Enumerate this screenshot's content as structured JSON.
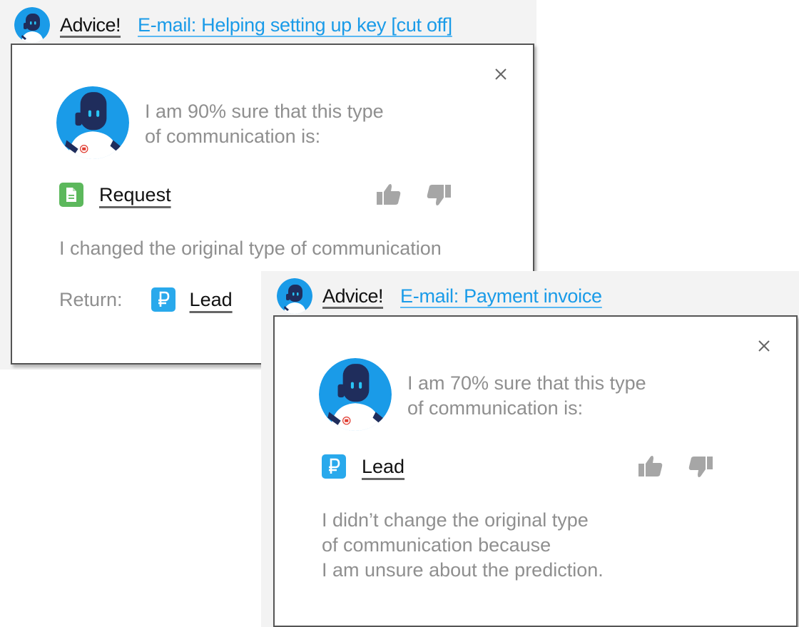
{
  "colors": {
    "accent_blue": "#1a9be8",
    "request_green": "#5cb85c",
    "lead_blue": "#29a9ec",
    "muted_text": "#8f8f8f",
    "thumb_gray": "#a6a6a6",
    "robot_navy": "#1f2d5c"
  },
  "cards": [
    {
      "header": {
        "advice_label": "Advice!",
        "email_link": "E-mail: Helping setting up key [cut off]"
      },
      "close_icon": "close-icon",
      "confidence_line1": "I am 90% sure that this type",
      "confidence_line2": "of communication is:",
      "confidence_percent": 90,
      "predicted_type": {
        "label": "Request",
        "icon": "document-icon"
      },
      "feedback": {
        "like_icon": "thumbs-up-icon",
        "dislike_icon": "thumbs-down-icon"
      },
      "note_lines": [
        "I changed the original type of communication"
      ],
      "return": {
        "label": "Return:",
        "type_label": "Lead",
        "icon": "ruble-icon"
      }
    },
    {
      "header": {
        "advice_label": "Advice!",
        "email_link": "E-mail: Payment invoice"
      },
      "close_icon": "close-icon",
      "confidence_line1": "I am 70% sure that this type",
      "confidence_line2": "of communication is:",
      "confidence_percent": 70,
      "predicted_type": {
        "label": "Lead",
        "icon": "ruble-icon"
      },
      "feedback": {
        "like_icon": "thumbs-up-icon",
        "dislike_icon": "thumbs-down-icon"
      },
      "note_lines": [
        "I didn’t change the original type",
        "of communication because",
        "I am unsure about the prediction."
      ]
    }
  ]
}
